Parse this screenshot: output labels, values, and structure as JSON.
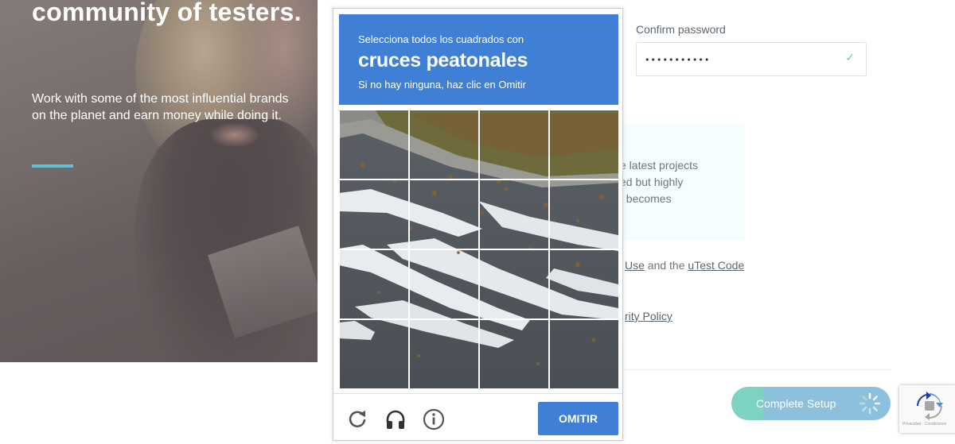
{
  "hero": {
    "title": "community of testers.",
    "description": "Work with some of the most influential brands on the planet and earn money while doing it."
  },
  "form": {
    "confirm_password_label": "Confirm password",
    "confirm_password_value": "•••••••••••",
    "check_icon": "check-icon",
    "info_lines": [
      "e latest projects",
      "ed but highly",
      "t becomes"
    ],
    "legal": {
      "terms_fragment": "Use",
      "and_the": " and the ",
      "code_link": "uTest Code",
      "privacy_fragment": "rity Policy"
    },
    "complete_button": "Complete Setup"
  },
  "captcha": {
    "instruction": "Selecciona todos los cuadrados con",
    "target": "cruces peatonales",
    "hint": "Si no hay ninguna, haz clic en Omitir",
    "skip_button": "OMITIR",
    "tools": [
      "reload-icon",
      "audio-icon",
      "info-icon"
    ]
  },
  "recaptcha_badge": {
    "terms": "Privacidad - Condiciones"
  },
  "colors": {
    "captcha_blue": "#3f7fd6",
    "accent_teal": "#5fc0d6",
    "button_green": "#7cd3c1",
    "button_blue": "#8cc0dc"
  }
}
